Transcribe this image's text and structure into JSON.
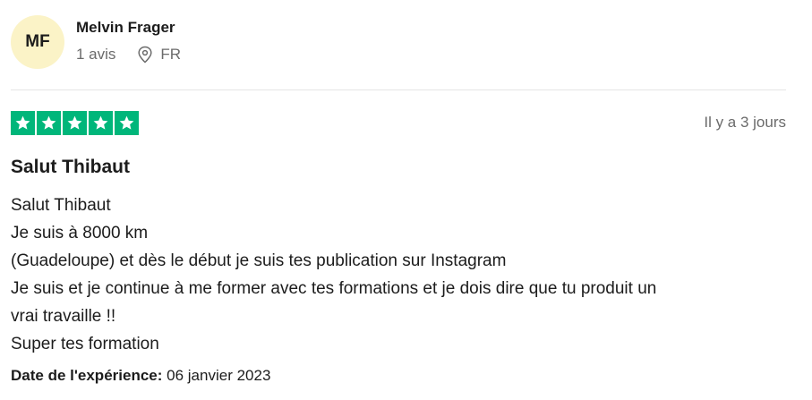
{
  "reviewer": {
    "initials": "MF",
    "name": "Melvin Frager",
    "review_count": "1 avis",
    "country": "FR"
  },
  "rating": {
    "stars": 5,
    "max": 5,
    "star_color": "#00b67a",
    "time_ago": "Il y a 3 jours"
  },
  "review": {
    "title": "Salut Thibaut",
    "lines": [
      "Salut Thibaut",
      "Je suis à 8000 km",
      "(Guadeloupe) et dès le début je suis tes publication sur Instagram",
      "Je suis et je continue à me former avec tes formations et je dois dire que tu produit un",
      "vrai travaille !!",
      "Super tes formation"
    ],
    "experience_label": "Date de l'expérience:",
    "experience_date": "06 janvier 2023"
  },
  "colors": {
    "avatar_bg": "#fbf3c7",
    "text": "#1c1c1c",
    "muted": "#6b6b6b",
    "divider": "#e5e5e5"
  },
  "icons": {
    "location": "location-pin-icon",
    "star": "star-icon"
  }
}
